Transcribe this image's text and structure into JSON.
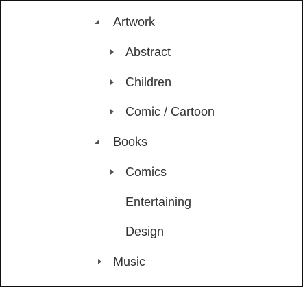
{
  "tree": {
    "nodes": [
      {
        "label": "Artwork",
        "level": 0,
        "state": "expanded",
        "icon": "caret-down-icon"
      },
      {
        "label": "Abstract",
        "level": 1,
        "state": "collapsed",
        "icon": "caret-right-icon"
      },
      {
        "label": "Children",
        "level": 1,
        "state": "collapsed",
        "icon": "caret-right-icon"
      },
      {
        "label": "Comic / Cartoon",
        "level": 1,
        "state": "collapsed",
        "icon": "caret-right-icon"
      },
      {
        "label": "Books",
        "level": 0,
        "state": "expanded",
        "icon": "caret-down-icon"
      },
      {
        "label": "Comics",
        "level": 1,
        "state": "collapsed",
        "icon": "caret-right-icon"
      },
      {
        "label": "Entertaining",
        "level": 1,
        "state": "leaf",
        "icon": ""
      },
      {
        "label": "Design",
        "level": 1,
        "state": "leaf",
        "icon": ""
      },
      {
        "label": "Music",
        "level": 0,
        "state": "collapsed",
        "icon": "caret-right-icon"
      }
    ]
  },
  "colors": {
    "text": "#333333",
    "icon": "#555555",
    "border": "#111111",
    "background": "#ffffff"
  }
}
